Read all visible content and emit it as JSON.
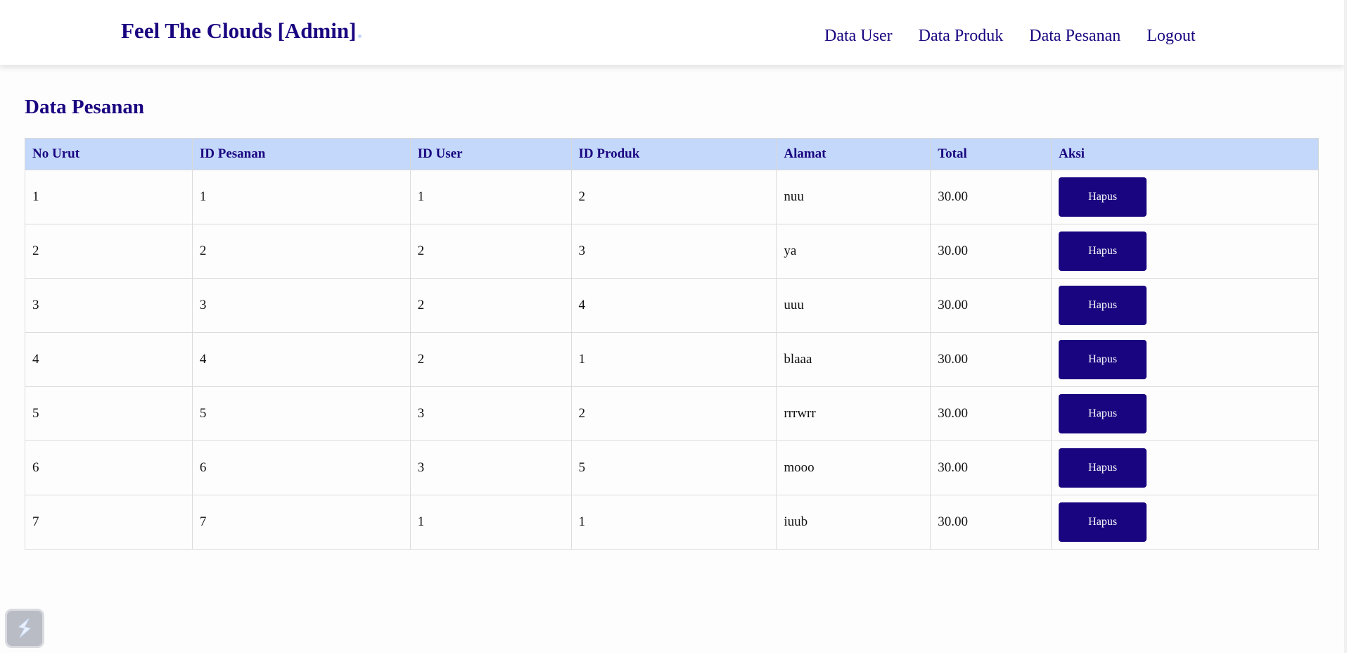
{
  "header": {
    "brand": "Feel The Clouds [Admin]",
    "nav": [
      "Data User",
      "Data Produk",
      "Data Pesanan",
      "Logout"
    ]
  },
  "main": {
    "title": "Data Pesanan",
    "table": {
      "headers": [
        "No Urut",
        "ID Pesanan",
        "ID User",
        "ID Produk",
        "Alamat",
        "Total",
        "Aksi"
      ],
      "rows": [
        [
          "1",
          "1",
          "1",
          "2",
          "nuu",
          "30.00",
          "Hapus"
        ],
        [
          "2",
          "2",
          "2",
          "3",
          "ya",
          "30.00",
          "Hapus"
        ],
        [
          "3",
          "3",
          "2",
          "4",
          "uuu",
          "30.00",
          "Hapus"
        ],
        [
          "4",
          "4",
          "2",
          "1",
          "blaaa",
          "30.00",
          "Hapus"
        ],
        [
          "5",
          "5",
          "3",
          "2",
          "rrrwrr",
          "30.00",
          "Hapus"
        ],
        [
          "6",
          "6",
          "3",
          "5",
          "mooo",
          "30.00",
          "Hapus"
        ],
        [
          "7",
          "7",
          "1",
          "1",
          "iuub",
          "30.00",
          "Hapus"
        ]
      ]
    }
  },
  "widget": {
    "icon": "lightning-icon"
  },
  "colors": {
    "brand": "#1a0580",
    "table_header_bg": "#c3d8fb"
  }
}
